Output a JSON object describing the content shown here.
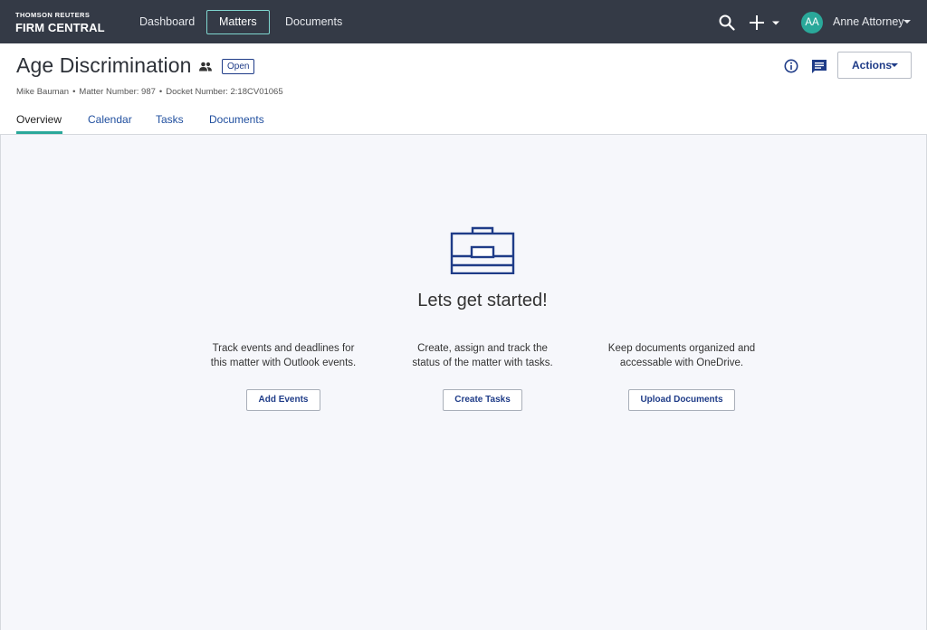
{
  "brand": {
    "top": "THOMSON REUTERS",
    "bottom": "FIRM CENTRAL"
  },
  "nav": {
    "tabs": [
      {
        "label": "Dashboard",
        "active": false
      },
      {
        "label": "Matters",
        "active": true
      },
      {
        "label": "Documents",
        "active": false
      }
    ],
    "search_icon": "search-icon",
    "add_icon": "plus-icon",
    "user": {
      "initials": "AA",
      "name": "Anne Attorney",
      "avatar_color": "#2aa89a"
    }
  },
  "matter": {
    "title": "Age Discrimination",
    "status": "Open",
    "client": "Mike Bauman",
    "matter_number": "Matter Number: 987",
    "docket_number": "Docket Number: 2:18CV01065",
    "actions_label": "Actions"
  },
  "subtabs": [
    {
      "label": "Overview",
      "active": true
    },
    {
      "label": "Calendar",
      "active": false
    },
    {
      "label": "Tasks",
      "active": false
    },
    {
      "label": "Documents",
      "active": false
    }
  ],
  "main": {
    "title": "Lets get started!",
    "columns": [
      {
        "line1": "Track events and deadlines for",
        "line2": "this matter with Outlook events.",
        "button": "Add Events"
      },
      {
        "line1": "Create, assign and track the",
        "line2": "status of the matter with tasks.",
        "button": "Create Tasks"
      },
      {
        "line1": "Keep documents organized and",
        "line2": "accessable with OneDrive.",
        "button": "Upload Documents"
      }
    ]
  },
  "colors": {
    "nav_bg": "#343a46",
    "accent": "#2aa89a",
    "link": "#1f3c88",
    "active_tab_border": "#7fd6cf"
  }
}
